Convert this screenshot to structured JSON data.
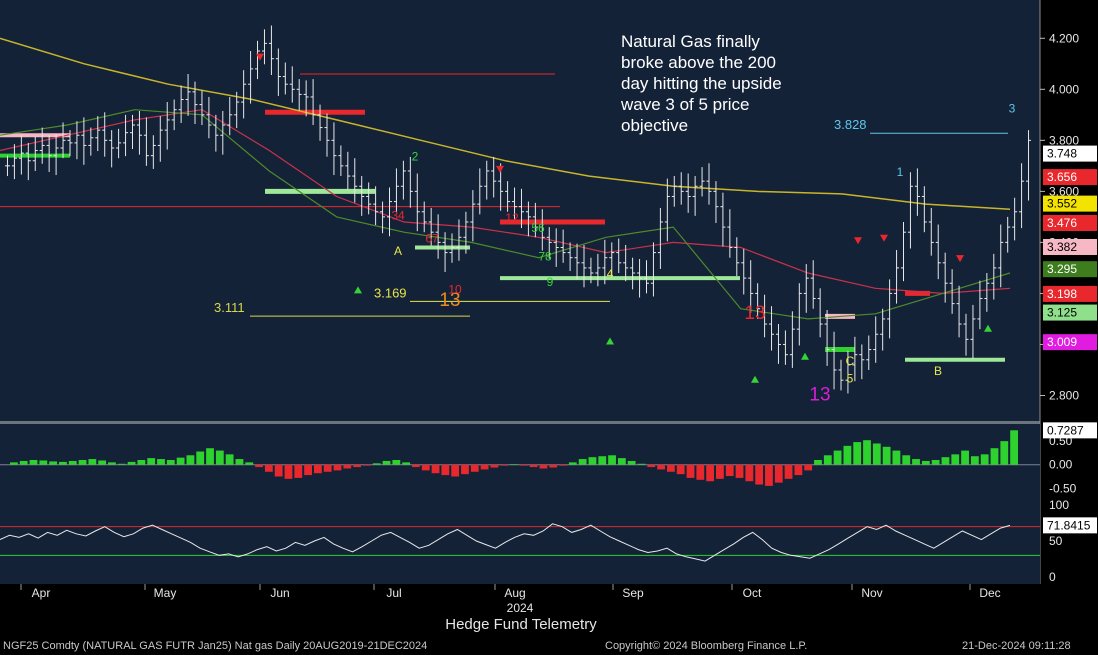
{
  "chart_data": {
    "type": "bar",
    "ticker_line": "NGF25 Comdty (NATURAL GAS FUTR  Jan25) Nat gas  Daily 20AUG2019-21DEC2024",
    "caption": "Hedge Fund Telemetry",
    "copyright": "Copyright© 2024 Bloomberg Finance L.P.",
    "timestamp": "21-Dec-2024 09:11:28",
    "annotation": [
      "Natural Gas finally",
      "broke above the 200",
      "day hitting the upside",
      "wave 3 of 5 price",
      "objective"
    ],
    "x_month_labels": [
      "Apr",
      "May",
      "Jun",
      "Jul",
      "Aug",
      "Sep",
      "Oct",
      "Nov",
      "Dec"
    ],
    "x_year_label": "2024",
    "price_axis": {
      "range": [
        2.7,
        4.35
      ],
      "ticks": [
        "4.200",
        "4.000",
        "3.800",
        "3.600",
        "3.400",
        "3.200",
        "3.000",
        "2.800"
      ]
    },
    "price_badges": [
      {
        "label": "3.748",
        "value": 3.748,
        "bg": "#ffffff",
        "fg": "#000000"
      },
      {
        "label": "3.656",
        "value": 3.656,
        "bg": "#e8282c",
        "fg": "#ffffff"
      },
      {
        "label": "3.552",
        "value": 3.552,
        "bg": "#f3e300",
        "fg": "#000000"
      },
      {
        "label": "3.476",
        "value": 3.476,
        "bg": "#e8282c",
        "fg": "#ffffff"
      },
      {
        "label": "3.382",
        "value": 3.382,
        "bg": "#f6b8c4",
        "fg": "#000000"
      },
      {
        "label": "3.295",
        "value": 3.295,
        "bg": "#3e7d1e",
        "fg": "#ffffff"
      },
      {
        "label": "3.198",
        "value": 3.198,
        "bg": "#e8282c",
        "fg": "#ffffff"
      },
      {
        "label": "3.125",
        "value": 3.125,
        "bg": "#8fe08a",
        "fg": "#000000"
      },
      {
        "label": "3.009",
        "value": 3.009,
        "bg": "#e21be1",
        "fg": "#ffffff"
      }
    ],
    "price_levels": [
      {
        "label": "3.828",
        "value": 3.828,
        "color": "#5ec8e8"
      },
      {
        "label": "3.169",
        "value": 3.169,
        "color": "#e6e64a"
      },
      {
        "label": "3.111",
        "value": 3.111,
        "color": "#d7d74a"
      }
    ],
    "closes": [
      3.7,
      3.73,
      3.75,
      3.72,
      3.76,
      3.78,
      3.74,
      3.77,
      3.8,
      3.79,
      3.82,
      3.78,
      3.81,
      3.84,
      3.8,
      3.77,
      3.79,
      3.83,
      3.86,
      3.82,
      3.74,
      3.78,
      3.84,
      3.88,
      3.92,
      3.96,
      3.99,
      3.94,
      3.9,
      3.86,
      3.82,
      3.86,
      3.9,
      3.95,
      4.02,
      4.08,
      4.15,
      4.18,
      4.12,
      4.05,
      4.02,
      4.0,
      3.98,
      3.97,
      3.9,
      3.85,
      3.8,
      3.74,
      3.7,
      3.66,
      3.62,
      3.58,
      3.55,
      3.52,
      3.5,
      3.56,
      3.62,
      3.68,
      3.6,
      3.52,
      3.48,
      3.44,
      3.4,
      3.36,
      3.38,
      3.42,
      3.48,
      3.55,
      3.62,
      3.68,
      3.64,
      3.6,
      3.56,
      3.54,
      3.52,
      3.5,
      3.46,
      3.42,
      3.4,
      3.38,
      3.36,
      3.34,
      3.32,
      3.3,
      3.28,
      3.3,
      3.34,
      3.36,
      3.32,
      3.3,
      3.28,
      3.26,
      3.24,
      3.36,
      3.48,
      3.58,
      3.62,
      3.6,
      3.58,
      3.62,
      3.64,
      3.6,
      3.54,
      3.46,
      3.38,
      3.32,
      3.26,
      3.2,
      3.14,
      3.08,
      3.04,
      3.0,
      2.96,
      3.06,
      3.2,
      3.26,
      3.18,
      3.08,
      2.98,
      2.9,
      2.86,
      2.92,
      2.96,
      2.94,
      2.98,
      3.04,
      3.1,
      3.2,
      3.3,
      3.44,
      3.62,
      3.58,
      3.48,
      3.4,
      3.32,
      3.24,
      3.16,
      3.08,
      3.02,
      3.1,
      3.18,
      3.24,
      3.3,
      3.4,
      3.46,
      3.52,
      3.64,
      3.8
    ],
    "ma_200": {
      "name": "200 day",
      "values": [
        4.2,
        4.1,
        4.02,
        3.96,
        3.88,
        3.8,
        3.72,
        3.66,
        3.62,
        3.6,
        3.59,
        3.55,
        3.53
      ]
    },
    "ma_50": {
      "values": [
        3.82,
        3.86,
        3.92,
        3.9,
        3.68,
        3.5,
        3.44,
        3.4,
        3.34,
        3.42,
        3.46,
        3.14,
        3.1,
        3.12,
        3.2,
        3.28
      ]
    },
    "ma_100": {
      "values": [
        3.76,
        3.82,
        3.88,
        3.92,
        3.76,
        3.58,
        3.48,
        3.46,
        3.42,
        3.36,
        3.4,
        3.38,
        3.28,
        3.22,
        3.2,
        3.22
      ]
    },
    "sequential_labels": [
      {
        "text": "13",
        "color": "#d61fd6"
      },
      {
        "text": "13",
        "color": "#f08a1e"
      },
      {
        "text": "13",
        "color": "#e8282c"
      },
      {
        "text": "9",
        "color": "#35d435"
      },
      {
        "text": "A",
        "color": "#e6e64a"
      },
      {
        "text": "B",
        "color": "#e6e64a"
      },
      {
        "text": "C",
        "color": "#e6e64a"
      },
      {
        "text": "1",
        "color": "#5ec8e8"
      },
      {
        "text": "2",
        "color": "#35d435"
      },
      {
        "text": "3",
        "color": "#5ec8e8"
      },
      {
        "text": "4",
        "color": "#e6e64a"
      },
      {
        "text": "5",
        "color": "#e6e64a"
      },
      {
        "text": "10",
        "color": "#e8282c"
      },
      {
        "text": "12",
        "color": "#e8282c"
      },
      {
        "text": "34",
        "color": "#e8282c"
      },
      {
        "text": "67",
        "color": "#e8282c"
      },
      {
        "text": "56",
        "color": "#35d435"
      },
      {
        "text": "78",
        "color": "#35d435"
      }
    ],
    "macd": {
      "range": [
        -0.6,
        0.8
      ],
      "ticks": [
        "0.50",
        "0.00",
        "-0.50"
      ],
      "badge": {
        "label": "0.7287",
        "value": 0.7287
      },
      "values": [
        0.05,
        0.08,
        0.1,
        0.09,
        0.07,
        0.06,
        0.08,
        0.1,
        0.12,
        0.09,
        0.05,
        0.02,
        0.06,
        0.1,
        0.14,
        0.12,
        0.1,
        0.15,
        0.2,
        0.28,
        0.35,
        0.3,
        0.22,
        0.12,
        0.05,
        -0.05,
        -0.15,
        -0.25,
        -0.3,
        -0.28,
        -0.22,
        -0.18,
        -0.15,
        -0.12,
        -0.08,
        -0.05,
        -0.02,
        0.03,
        0.08,
        0.1,
        0.05,
        -0.05,
        -0.12,
        -0.18,
        -0.22,
        -0.25,
        -0.2,
        -0.15,
        -0.1,
        -0.06,
        -0.02,
        0.01,
        -0.02,
        -0.05,
        -0.08,
        -0.06,
        -0.02,
        0.05,
        0.12,
        0.16,
        0.18,
        0.2,
        0.14,
        0.08,
        0.02,
        -0.05,
        -0.1,
        -0.15,
        -0.2,
        -0.28,
        -0.32,
        -0.35,
        -0.3,
        -0.24,
        -0.28,
        -0.35,
        -0.42,
        -0.45,
        -0.38,
        -0.3,
        -0.22,
        -0.12,
        0.1,
        0.2,
        0.3,
        0.4,
        0.48,
        0.52,
        0.45,
        0.38,
        0.3,
        0.2,
        0.12,
        0.08,
        0.1,
        0.16,
        0.22,
        0.3,
        0.18,
        0.22,
        0.35,
        0.5,
        0.73
      ]
    },
    "rsi": {
      "range": [
        -10,
        110
      ],
      "ticks": [
        "100",
        "50",
        "0"
      ],
      "badge": {
        "label": "71.8415",
        "value": 71.8415
      },
      "overbought": 70,
      "oversold": 30,
      "values": [
        52,
        58,
        55,
        60,
        54,
        62,
        58,
        65,
        60,
        57,
        64,
        70,
        62,
        56,
        60,
        68,
        72,
        66,
        60,
        54,
        48,
        40,
        35,
        30,
        32,
        28,
        32,
        38,
        42,
        36,
        40,
        48,
        44,
        50,
        55,
        46,
        40,
        35,
        42,
        50,
        58,
        62,
        55,
        48,
        40,
        44,
        52,
        60,
        66,
        58,
        50,
        45,
        40,
        48,
        55,
        60,
        58,
        64,
        74,
        70,
        62,
        66,
        72,
        64,
        56,
        50,
        44,
        38,
        34,
        36,
        40,
        32,
        28,
        25,
        22,
        30,
        38,
        46,
        55,
        62,
        52,
        40,
        34,
        30,
        28,
        26,
        32,
        38,
        46,
        54,
        62,
        70,
        66,
        72,
        64,
        58,
        52,
        46,
        40,
        48,
        56,
        64,
        58,
        52,
        60,
        68,
        71.8
      ]
    }
  }
}
